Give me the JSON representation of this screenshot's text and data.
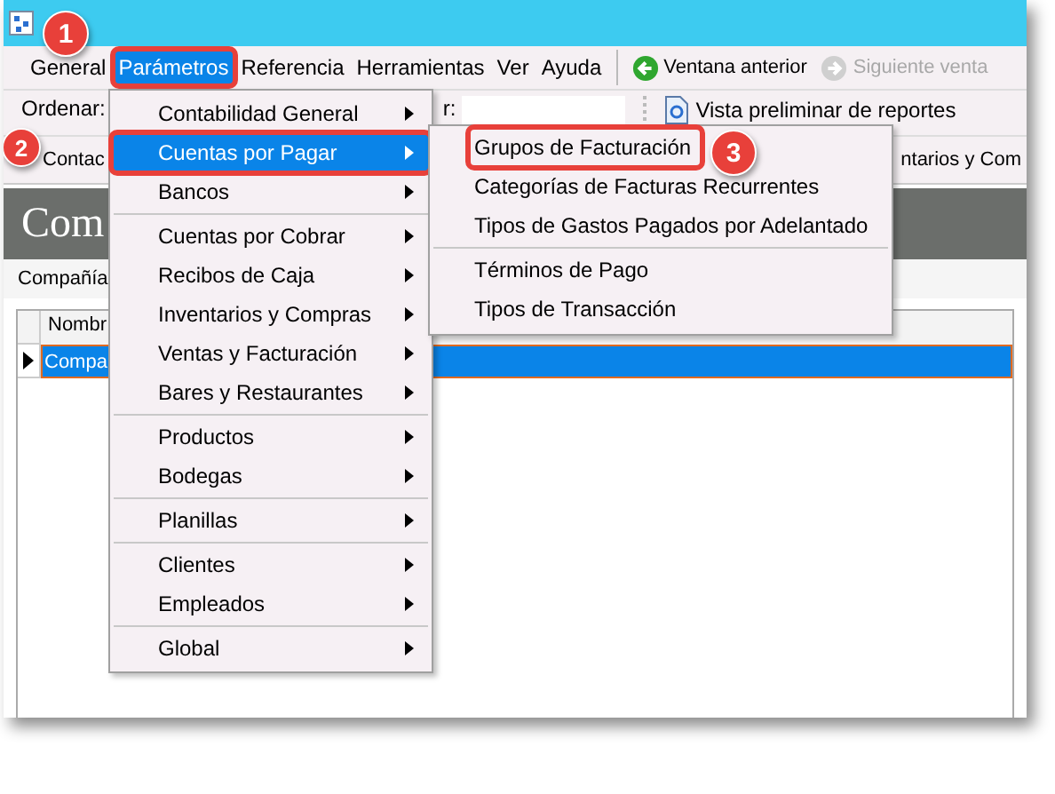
{
  "menu_bar": [
    {
      "label": "General",
      "selected": false
    },
    {
      "label": "Parámetros",
      "selected": true,
      "highlighted": true
    },
    {
      "label": "Referencia",
      "selected": false
    },
    {
      "label": "Herramientas",
      "selected": false
    },
    {
      "label": "Ver",
      "selected": false
    },
    {
      "label": "Ayuda",
      "selected": false
    }
  ],
  "nav_buttons": [
    {
      "label": "Ventana anterior",
      "disabled": false,
      "kind": "back"
    },
    {
      "label": "Siguiente venta",
      "disabled": true,
      "kind": "forward"
    }
  ],
  "toolbar": {
    "sort_label": "Ordenar:",
    "search_label": "r:",
    "preview_button": "Vista preliminar de reportes"
  },
  "toolbar_row_2": {
    "label": "Contac",
    "button": "ntarios y Com"
  },
  "header": {
    "title": "Com"
  },
  "tab": "Compañía",
  "grid": {
    "columns": [
      "Nombr"
    ],
    "rows": [
      {
        "cells": [
          "Compa"
        ],
        "selected": true
      }
    ]
  },
  "menu": {
    "groups": [
      [
        {
          "label": "Contabilidad General",
          "selected": false,
          "highlighted": false
        },
        {
          "label": "Cuentas por Pagar",
          "selected": true,
          "highlighted": true
        },
        {
          "label": "Bancos",
          "selected": false,
          "highlighted": false
        }
      ],
      [
        {
          "label": "Cuentas por Cobrar",
          "selected": false,
          "highlighted": false
        },
        {
          "label": "Recibos de Caja",
          "selected": false,
          "highlighted": false
        },
        {
          "label": "Inventarios y Compras",
          "selected": false,
          "highlighted": false
        },
        {
          "label": "Ventas y Facturación",
          "selected": false,
          "highlighted": false
        },
        {
          "label": "Bares y Restaurantes",
          "selected": false,
          "highlighted": false
        }
      ],
      [
        {
          "label": "Productos",
          "selected": false,
          "highlighted": false
        },
        {
          "label": "Bodegas",
          "selected": false,
          "highlighted": false
        }
      ],
      [
        {
          "label": "Planillas",
          "selected": false,
          "highlighted": false
        }
      ],
      [
        {
          "label": "Clientes",
          "selected": false,
          "highlighted": false
        },
        {
          "label": "Empleados",
          "selected": false,
          "highlighted": false
        }
      ],
      [
        {
          "label": "Global",
          "selected": false,
          "highlighted": false
        }
      ]
    ]
  },
  "submenu": {
    "groups": [
      [
        {
          "label": "Grupos de Facturación",
          "selected": false,
          "highlighted": true
        },
        {
          "label": "Categorías de Facturas Recurrentes",
          "selected": false,
          "highlighted": false
        },
        {
          "label": "Tipos de Gastos Pagados por Adelantado",
          "selected": false,
          "highlighted": false
        }
      ],
      [
        {
          "label": "Términos de Pago",
          "selected": false,
          "highlighted": false
        },
        {
          "label": "Tipos de Transacción",
          "selected": false,
          "highlighted": false
        }
      ]
    ]
  },
  "callouts": [
    "1",
    "2",
    "3"
  ]
}
